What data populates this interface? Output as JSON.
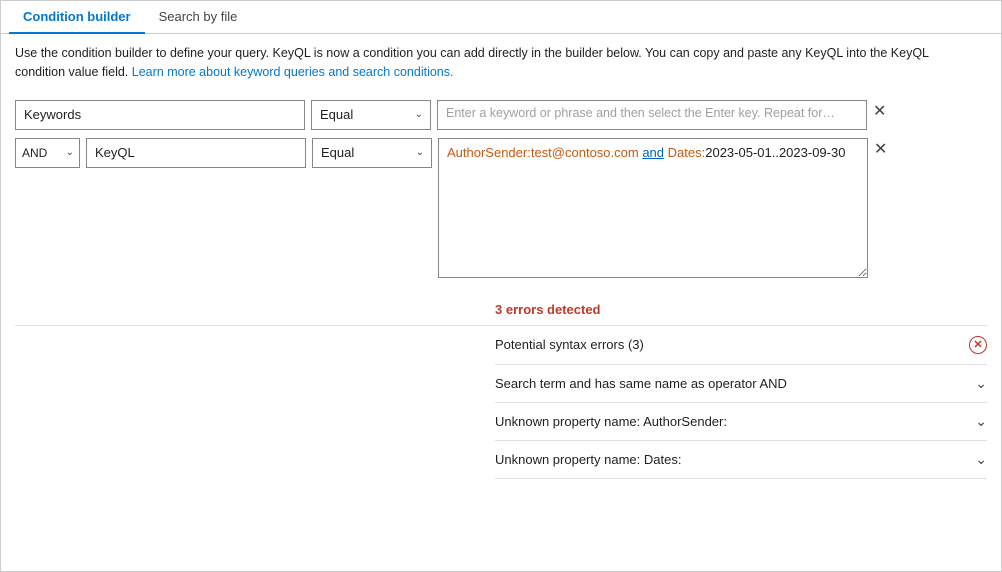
{
  "tabs": [
    {
      "id": "condition-builder",
      "label": "Condition builder",
      "active": true
    },
    {
      "id": "search-by-file",
      "label": "Search by file",
      "active": false
    }
  ],
  "description": {
    "main_text": "Use the condition builder to define your query. KeyQL is now a condition you can add directly in the builder below. You can copy and paste any KeyQL into the KeyQL condition value field.",
    "link_text": "Learn more about keyword queries and search conditions.",
    "link_href": "#"
  },
  "rows": [
    {
      "id": "row1",
      "field": "Keywords",
      "operator": "Equal",
      "value_placeholder": "Enter a keyword or phrase and then select the Enter key. Repeat for additional...",
      "value": ""
    },
    {
      "id": "row2",
      "conjunction": "AND",
      "field": "KeyQL",
      "operator": "Equal",
      "value": "AuthorSender:test@contoso.com and Dates:2023-05-01..2023-09-30"
    }
  ],
  "errors": {
    "count_label": "3 errors detected",
    "group_label": "Potential syntax errors (3)",
    "items": [
      {
        "label": "Search term and has same name as operator AND"
      },
      {
        "label": "Unknown property name: AuthorSender:"
      },
      {
        "label": "Unknown property name: Dates:"
      }
    ]
  },
  "icons": {
    "close": "✕",
    "chevron_down": "∨",
    "error_x": "✕"
  }
}
